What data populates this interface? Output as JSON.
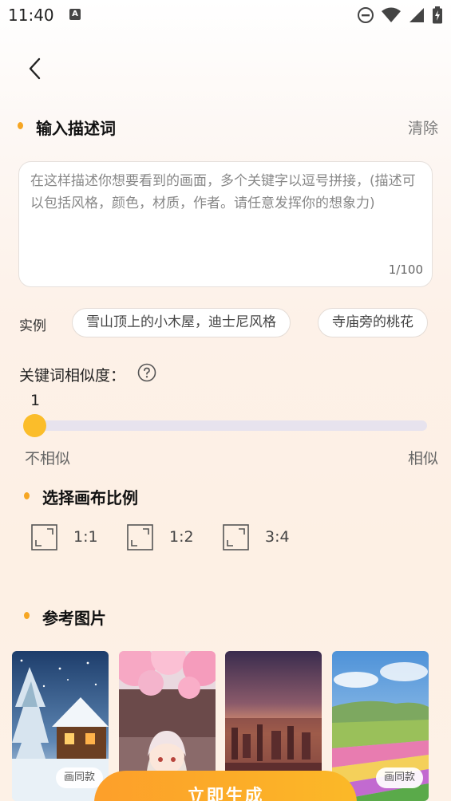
{
  "status_bar": {
    "time": "11:40",
    "notification_glyph": "A"
  },
  "header": {
    "back_icon": "chevron-left-icon"
  },
  "prompt_section": {
    "title": "输入描述词",
    "clear_label": "清除",
    "input_value": "",
    "placeholder": "在这样描述你想要看到的画面，多个关键字以逗号拼接，(描述可以包括风格，颜色，材质，作者。请任意发挥你的想象力)",
    "counter": "1/100"
  },
  "examples": {
    "label": "实例",
    "items": [
      "雪山顶上的小木屋，迪士尼风格",
      "寺庙旁的桃花"
    ]
  },
  "similarity": {
    "label": "关键词相似度：",
    "value": "1",
    "fraction": 0.0,
    "min_label": "不相似",
    "max_label": "相似"
  },
  "ratio_section": {
    "title": "选择画布比例",
    "options": [
      "1:1",
      "1:2",
      "3:4"
    ]
  },
  "reference_section": {
    "title": "参考图片",
    "badge_label": "画同款",
    "images": [
      "snowy-cabin-image",
      "cherry-blossom-girl-image",
      "sunset-city-image",
      "flower-field-image"
    ]
  },
  "generate_button": {
    "label": "立即生成"
  },
  "colors": {
    "accent": "#f6a623",
    "button": "#fcae28",
    "slider_thumb": "#fbbd2a",
    "track": "#e7e3ee"
  }
}
